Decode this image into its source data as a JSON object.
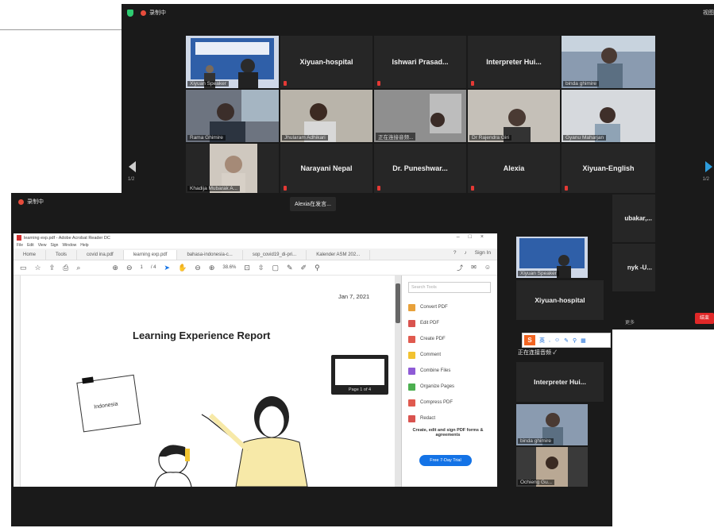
{
  "back_window": {
    "recording_label": "录制中",
    "view_label": "视图",
    "page_left": "1/2",
    "page_right": "1/2",
    "end_label": "结束",
    "more_label": "更多",
    "tiles": [
      {
        "name": "",
        "label": "Xiyuan Speaker",
        "type": "video",
        "active": true
      },
      {
        "name": "Xiyuan-hospital",
        "label": "",
        "type": "name"
      },
      {
        "name": "Ishwari Prasad...",
        "label": "",
        "type": "name"
      },
      {
        "name": "Interpreter Hui...",
        "label": "",
        "type": "name"
      },
      {
        "name": "",
        "label": "binda ghimire",
        "type": "video"
      },
      {
        "name": "",
        "label": "Rama Ghimire",
        "type": "video"
      },
      {
        "name": "",
        "label": "Jhularam Adhikari",
        "type": "video"
      },
      {
        "name": "",
        "label": "正在连接音频...",
        "type": "video"
      },
      {
        "name": "",
        "label": "Dr Rajendra Giri",
        "type": "video"
      },
      {
        "name": "",
        "label": "Gyanu Maharjan",
        "type": "video"
      },
      {
        "name": "",
        "label": "Khadija Mubarak A...",
        "type": "video"
      },
      {
        "name": "Narayani Nepal",
        "label": "",
        "type": "name"
      },
      {
        "name": "Dr. Puneshwar...",
        "label": "",
        "type": "name"
      },
      {
        "name": "Alexia",
        "label": "",
        "type": "name"
      },
      {
        "name": "Xiyuan-English",
        "label": "",
        "type": "name"
      }
    ],
    "partial_tiles": [
      "ubakar,...",
      "nyk -U..."
    ]
  },
  "front_window": {
    "recording_label": "录制中",
    "speaking_label": "Alexia在发言...",
    "acrobat": {
      "window_title": "learning exp.pdf - Adobe Acrobat Reader DC",
      "menu": [
        "File",
        "Edit",
        "View",
        "Sign",
        "Window",
        "Help"
      ],
      "tabs": [
        "Home",
        "Tools",
        "covid ina.pdf",
        "learning exp.pdf",
        "bahasa-indonesia-c...",
        "sop_covid19_di-pri...",
        "Kalender ASM 202..."
      ],
      "signin": "Sign In",
      "page_current": "1",
      "page_total": "/ 4",
      "zoom": "38.6%",
      "doc": {
        "date": "Jan 7, 2021",
        "title": "Learning Experience Report",
        "sticky_note": "Indonesia",
        "page_thumb_label": "Page 1 of 4"
      },
      "side_panel": {
        "search_placeholder": "Search Tools",
        "tools": [
          {
            "label": "Convert PDF",
            "color": "#e8a13a"
          },
          {
            "label": "Edit PDF",
            "color": "#d9534f"
          },
          {
            "label": "Create PDF",
            "color": "#e05a4f"
          },
          {
            "label": "Comment",
            "color": "#f2c230"
          },
          {
            "label": "Combine Files",
            "color": "#8e5bd6"
          },
          {
            "label": "Organize Pages",
            "color": "#4caf50"
          },
          {
            "label": "Compress PDF",
            "color": "#e05a4f"
          },
          {
            "label": "Redact",
            "color": "#d9534f"
          }
        ],
        "promo_text": "Create, edit and sign PDF forms & agreements",
        "trial_button": "Free 7-Day Trial"
      }
    },
    "side_tiles": [
      {
        "name": "",
        "label": "Xiyuan Speaker",
        "type": "video"
      },
      {
        "name": "Xiyuan-hospital",
        "label": "",
        "type": "name"
      },
      {
        "name": "Interpreter Hui...",
        "label": "",
        "type": "name"
      },
      {
        "name": "",
        "label": "binda ghimire",
        "type": "video"
      },
      {
        "name": "",
        "label": "Ochieng Gu...",
        "type": "video"
      }
    ],
    "ime_label": "英",
    "connecting_label": "正在连接音频 ✓"
  }
}
